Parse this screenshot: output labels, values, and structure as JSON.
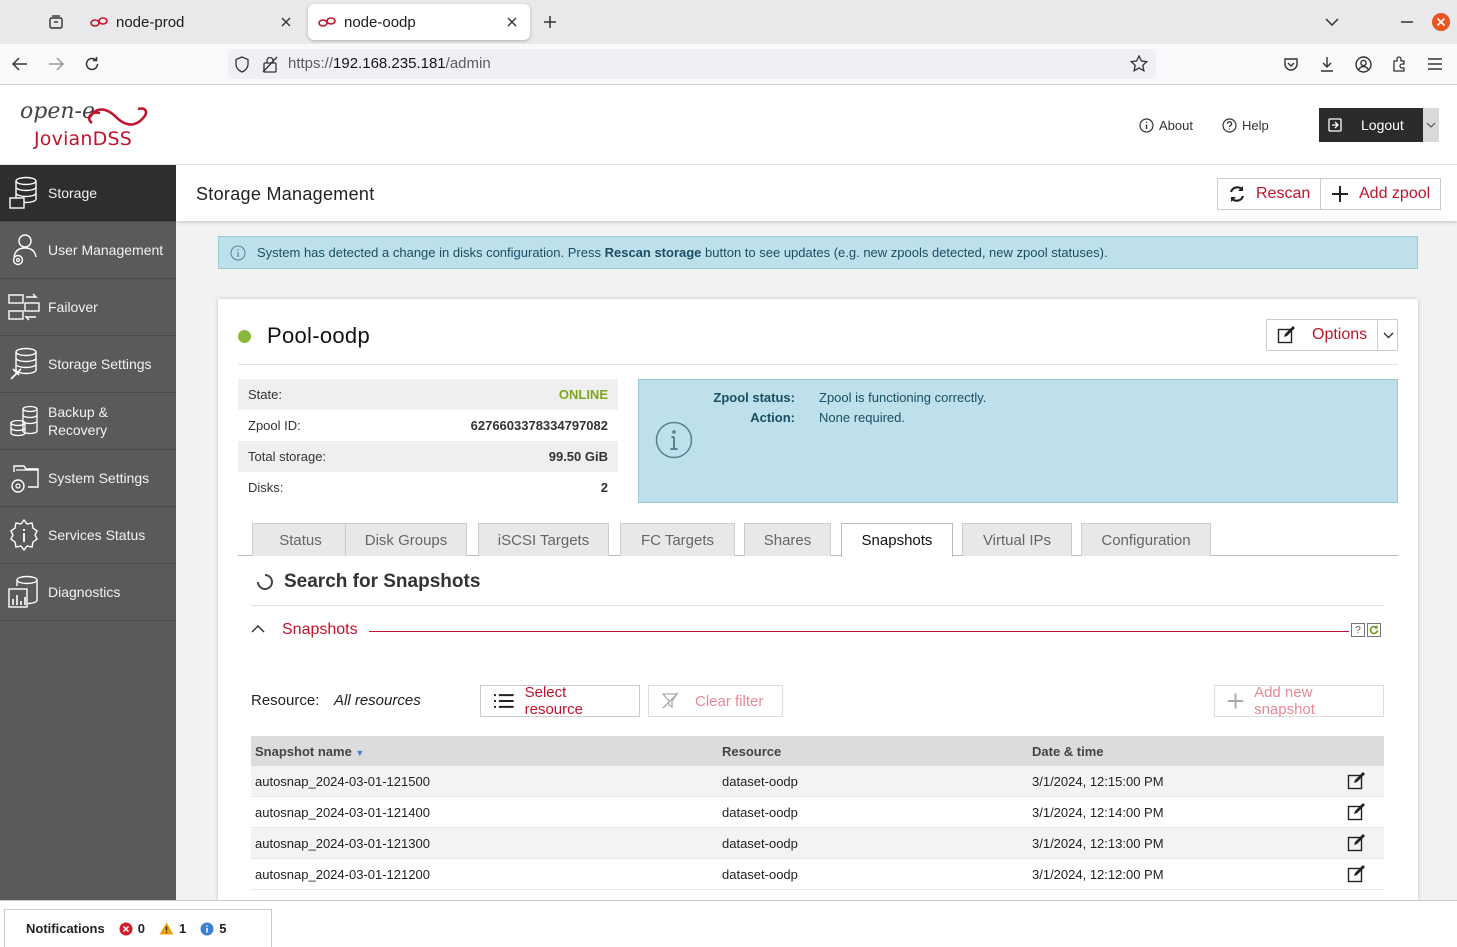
{
  "browser": {
    "tabs": [
      {
        "title": "node-prod",
        "active": false
      },
      {
        "title": "node-oodp",
        "active": true
      }
    ],
    "url_prefix": "https://",
    "url_host": "192.168.235.181",
    "url_path": "/admin"
  },
  "header": {
    "logo_line1": "open-e",
    "logo_line2": "JovianDSS",
    "about": "About",
    "help": "Help",
    "logout": "Logout"
  },
  "sidebar": {
    "items": [
      {
        "label": "Storage",
        "icon": "storage-icon",
        "active": true
      },
      {
        "label": "User Management",
        "icon": "user-management-icon",
        "active": false
      },
      {
        "label": "Failover",
        "icon": "failover-icon",
        "active": false
      },
      {
        "label": "Storage Settings",
        "icon": "storage-settings-icon",
        "active": false
      },
      {
        "label": "Backup & Recovery",
        "icon": "backup-recovery-icon",
        "active": false
      },
      {
        "label": "System Settings",
        "icon": "system-settings-icon",
        "active": false
      },
      {
        "label": "Services Status",
        "icon": "services-status-icon",
        "active": false
      },
      {
        "label": "Diagnostics",
        "icon": "diagnostics-icon",
        "active": false
      }
    ]
  },
  "page": {
    "title": "Storage Management",
    "rescan": "Rescan",
    "add_zpool": "Add zpool",
    "alert_pre": "System has detected a change in disks configuration. Press ",
    "alert_bold": "Rescan storage",
    "alert_post": " button to see updates (e.g. new zpools detected, new zpool statuses)."
  },
  "pool": {
    "name": "Pool-oodp",
    "options": "Options",
    "status_color": "#8ab83a",
    "info": [
      {
        "label": "State:",
        "value": "ONLINE"
      },
      {
        "label": "Zpool ID:",
        "value": "6276603378334797082"
      },
      {
        "label": "Total storage:",
        "value": "99.50 GiB"
      },
      {
        "label": "Disks:",
        "value": "2"
      }
    ],
    "zpool_status_label": "Zpool status:",
    "zpool_status_value": "Zpool is functioning correctly.",
    "action_label": "Action:",
    "action_value": "None required.",
    "tabs": [
      "Status",
      "Disk Groups",
      "iSCSI Targets",
      "FC Targets",
      "Shares",
      "Snapshots",
      "Virtual IPs",
      "Configuration"
    ],
    "active_tab": "Snapshots"
  },
  "snapshots": {
    "search_title": "Search for Snapshots",
    "section_title": "Snapshots",
    "resource_label": "Resource:",
    "resource_value": "All resources",
    "select_resource": "Select resource",
    "clear_filter": "Clear filter",
    "add_new": "Add new snapshot",
    "columns": [
      "Snapshot name",
      "Resource",
      "Date & time"
    ],
    "rows": [
      {
        "name": "autosnap_2024-03-01-121500",
        "resource": "dataset-oodp",
        "date": "3/1/2024, 12:15:00 PM"
      },
      {
        "name": "autosnap_2024-03-01-121400",
        "resource": "dataset-oodp",
        "date": "3/1/2024, 12:14:00 PM"
      },
      {
        "name": "autosnap_2024-03-01-121300",
        "resource": "dataset-oodp",
        "date": "3/1/2024, 12:13:00 PM"
      },
      {
        "name": "autosnap_2024-03-01-121200",
        "resource": "dataset-oodp",
        "date": "3/1/2024, 12:12:00 PM"
      }
    ]
  },
  "notifications": {
    "label": "Notifications",
    "errors": "0",
    "warnings": "1",
    "info": "5"
  },
  "colors": {
    "accent": "#c0142c",
    "sidebar_bg": "#5a5a5a",
    "sidebar_active": "#2e2e2e",
    "info_bg": "#bde0ea",
    "online": "#7ea61e"
  }
}
